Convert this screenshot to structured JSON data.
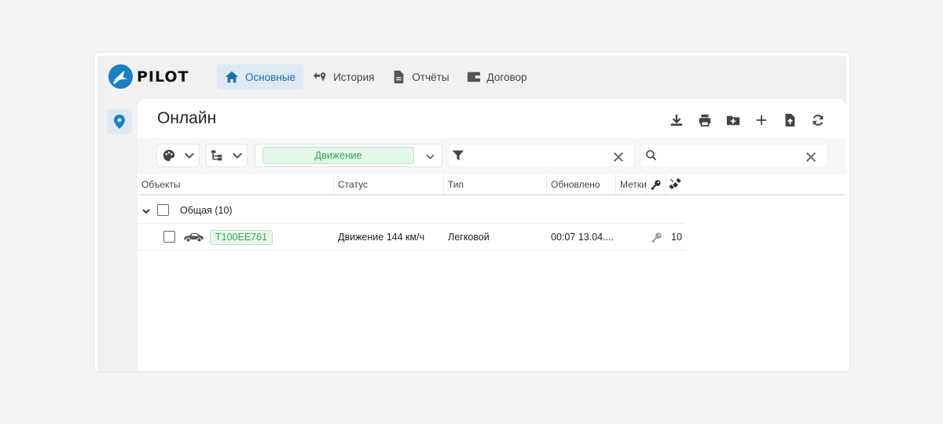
{
  "app": {
    "logo_text": "PILOT",
    "brand_color": "#1b7fc4"
  },
  "nav": {
    "items": [
      {
        "label": "Основные",
        "icon": "home-icon",
        "active": true
      },
      {
        "label": "История",
        "icon": "history-icon",
        "active": false
      },
      {
        "label": "Отчёты",
        "icon": "report-icon",
        "active": false
      },
      {
        "label": "Договор",
        "icon": "wallet-icon",
        "active": false
      }
    ]
  },
  "sidebar": {
    "items": [
      {
        "icon": "map-pin-icon",
        "active": true
      }
    ]
  },
  "panel": {
    "title": "Онлайн",
    "toolbar": [
      "download-icon",
      "print-icon",
      "folder-add-icon",
      "plus-icon",
      "file-upload-icon",
      "refresh-icon"
    ]
  },
  "filters": {
    "palette_icon": "palette-icon",
    "tree_icon": "tree-icon",
    "status_filter_value": "Движение",
    "status_filter_color": "#34a853",
    "filter_input_value": "",
    "search_input_value": ""
  },
  "table": {
    "columns": [
      "Объекты",
      "Статус",
      "Тип",
      "Обновлено",
      "Метки",
      "key-icon",
      "satellite-icon"
    ],
    "group": {
      "label": "Общая (10)"
    },
    "rows": [
      {
        "plate": "Т100ЕЕ761",
        "status": "Движение 144 км/ч",
        "type": "Легковой",
        "updated": "00:07 13.04....",
        "satellites": "10"
      }
    ]
  }
}
